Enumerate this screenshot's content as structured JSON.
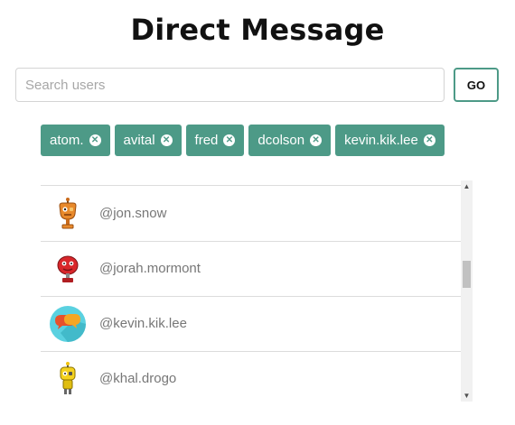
{
  "header": {
    "title": "Direct Message"
  },
  "search": {
    "placeholder": "Search users",
    "value": "",
    "go_label": "GO"
  },
  "selected_users": [
    {
      "label": "atom."
    },
    {
      "label": "avital"
    },
    {
      "label": "fred"
    },
    {
      "label": "dcolson"
    },
    {
      "label": "kevin.kik.lee"
    }
  ],
  "results": [
    {
      "username": "@jon.snow",
      "avatar": "orange-robot-icon"
    },
    {
      "username": "@jorah.mormont",
      "avatar": "red-robot-icon"
    },
    {
      "username": "@kevin.kik.lee",
      "avatar": "chat-bubbles-avatar"
    },
    {
      "username": "@khal.drogo",
      "avatar": "yellow-robot-icon"
    }
  ],
  "colors": {
    "accent": "#4d9a87",
    "avatar_teal": "#5ad1e0"
  }
}
